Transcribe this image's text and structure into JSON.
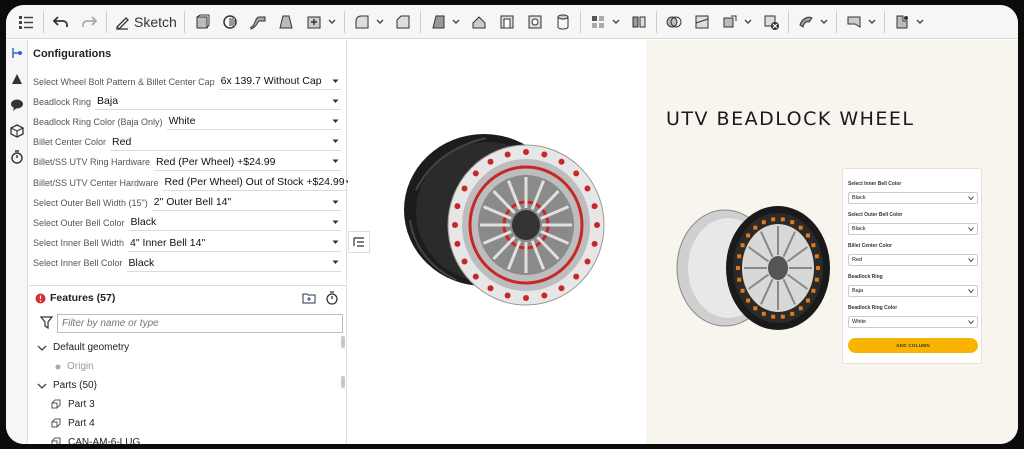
{
  "toolbar": {
    "sketch_label": "Sketch",
    "icons": [
      "feature-list-icon",
      "undo-icon",
      "redo-icon",
      "sketch-icon",
      "extrude-icon",
      "revolve-icon",
      "sweep-icon",
      "loft-icon",
      "thicken-icon",
      "fillet-icon",
      "chamfer-icon",
      "draft-icon",
      "rib-icon",
      "shell-icon",
      "hole-icon",
      "cylinder-icon",
      "pattern-icon",
      "mirror-icon",
      "boolean-icon",
      "split-icon",
      "transform-icon",
      "delete-part-icon",
      "sheet-metal-icon",
      "plane-icon",
      "mate-connector-icon"
    ]
  },
  "config": {
    "title": "Configurations",
    "rows": [
      {
        "label": "Select Wheel Bolt Pattern & Billet Center Cap",
        "value": "6x 139.7 Without Cap"
      },
      {
        "label": "Beadlock Ring",
        "value": "Baja"
      },
      {
        "label": "Beadlock Ring Color (Baja Only)",
        "value": "White"
      },
      {
        "label": "Billet Center Color",
        "value": "Red"
      },
      {
        "label": "Billet/SS UTV Ring Hardware",
        "value": "Red (Per Wheel) +$24.99"
      },
      {
        "label": "Billet/SS UTV Center Hardware",
        "value": "Red (Per Wheel) Out of Stock +$24.99"
      },
      {
        "label": "Select Outer Bell Width (15\")",
        "value": "2\" Outer Bell 14\""
      },
      {
        "label": "Select Outer Bell Color",
        "value": "Black"
      },
      {
        "label": "Select Inner Bell Width",
        "value": "4\" Inner Bell 14\""
      },
      {
        "label": "Select Inner Bell Color",
        "value": "Black"
      }
    ]
  },
  "features": {
    "title": "Features (57)",
    "filter_placeholder": "Filter by name or type",
    "items": [
      {
        "label": "Default geometry",
        "type": "group"
      },
      {
        "label": "Origin",
        "type": "sub"
      },
      {
        "label": "Parts (50)",
        "type": "group"
      },
      {
        "label": "Part 3",
        "type": "part"
      },
      {
        "label": "Part 4",
        "type": "part"
      },
      {
        "label": "CAN-AM-6-LUG",
        "type": "part"
      }
    ]
  },
  "product": {
    "title": "UTV BEADLOCK WHEEL",
    "options": [
      {
        "label": "Select Inner Bell Color",
        "value": "Black"
      },
      {
        "label": "Select Outer Bell Color",
        "value": "Black"
      },
      {
        "label": "Billet Center Color",
        "value": "Red"
      },
      {
        "label": "Beadlock Ring",
        "value": "Baja"
      },
      {
        "label": "Beadlock Ring Color",
        "value": "White"
      }
    ],
    "button_label": "ADD COLUMN",
    "accent_color": "#f8b400"
  }
}
